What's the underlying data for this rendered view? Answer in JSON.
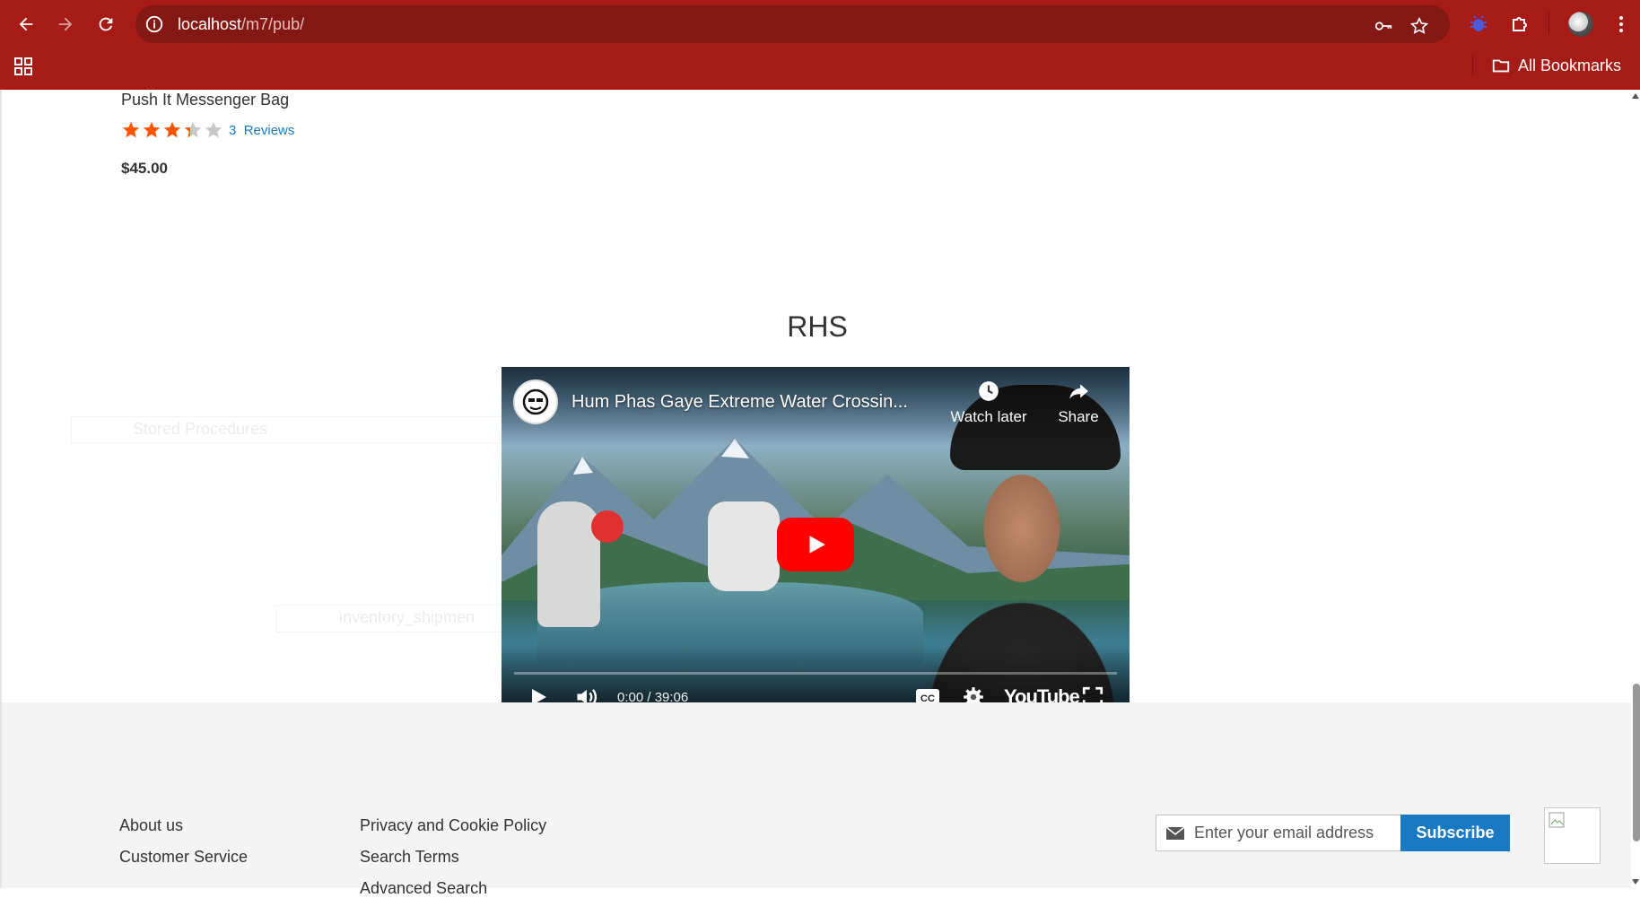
{
  "browser": {
    "url_host": "localhost",
    "url_path": "/m7/pub/",
    "bookmarks_label": "All Bookmarks"
  },
  "product": {
    "name": "Push It Messenger Bag",
    "rating": 0.67,
    "reviews_count": "3",
    "reviews_label": "Reviews",
    "price": "$45.00"
  },
  "section": {
    "title": "RHS"
  },
  "ghost_text": {
    "item1": "Stored Procedures",
    "item2": "inventory_shipmen"
  },
  "video": {
    "title": "Hum Phas Gaye Extreme Water Crossin...",
    "watch_later": "Watch later",
    "share": "Share",
    "time": "0:00 / 39:06",
    "brand": "YouTube",
    "progress": 0
  },
  "footer": {
    "links_col1": [
      "About us",
      "Customer Service"
    ],
    "links_col2": [
      "Privacy and Cookie Policy",
      "Search Terms",
      "Advanced Search"
    ],
    "newsletter_placeholder": "Enter your email address",
    "subscribe_label": "Subscribe"
  },
  "colors": {
    "chrome": "#a61b16",
    "link": "#1979c3",
    "star": "#ff5501",
    "youtube_red": "#ff0000"
  }
}
